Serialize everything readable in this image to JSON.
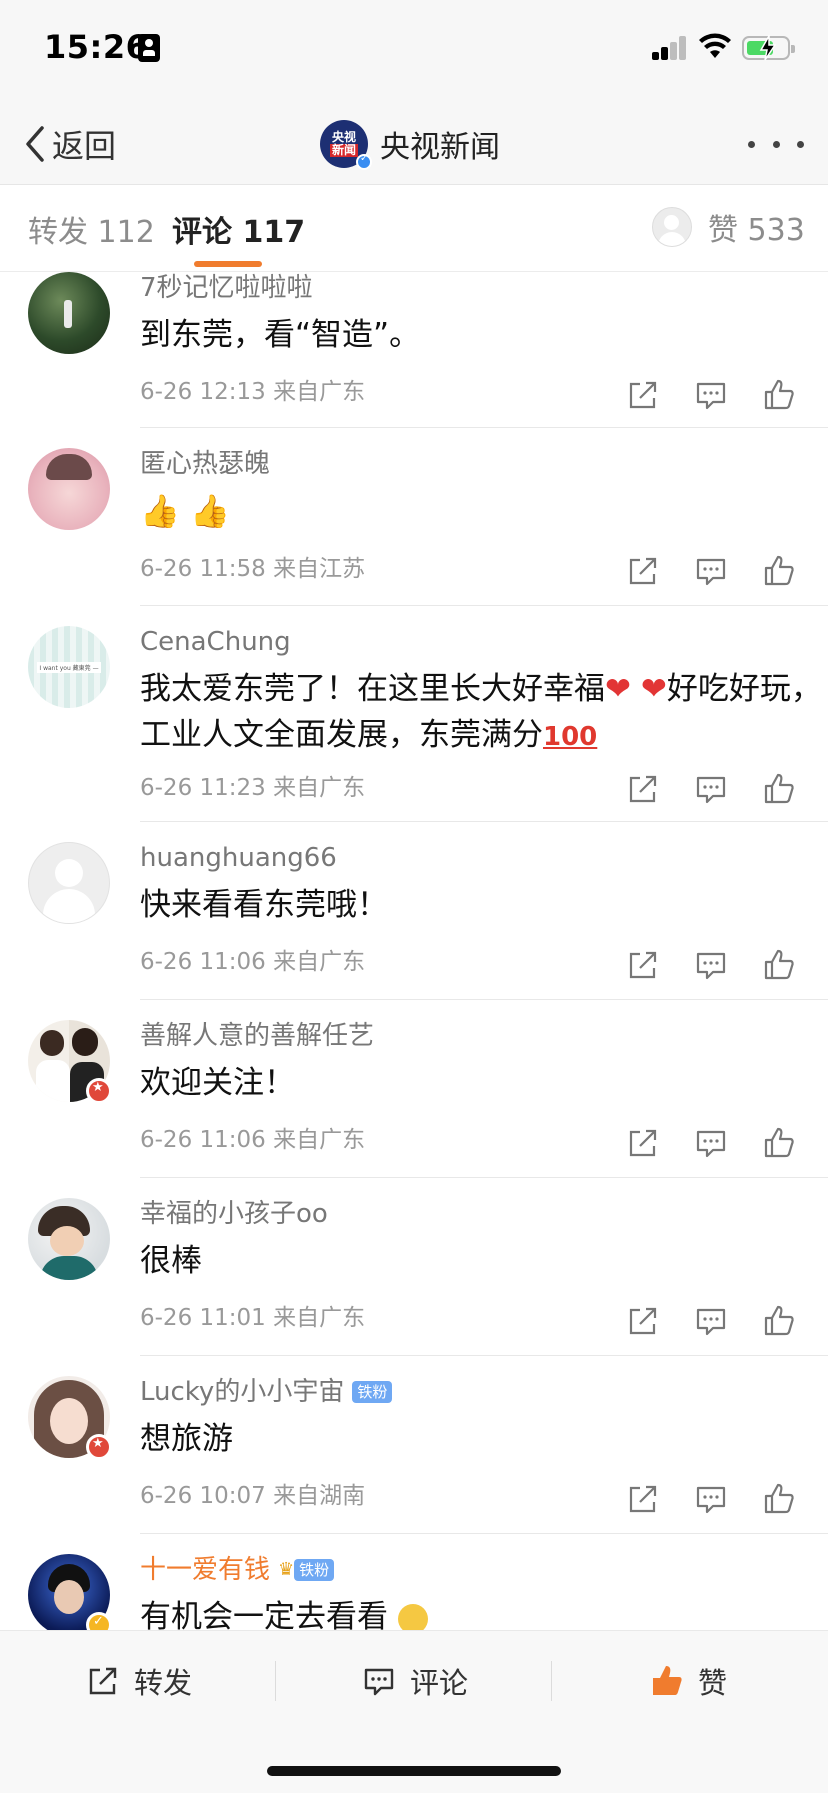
{
  "status_bar": {
    "time": "15:26"
  },
  "nav": {
    "back_label": "返回",
    "title": "央视新闻",
    "logo_line1": "央视",
    "logo_line2": "新闻"
  },
  "tabs": {
    "repost": "转发 112",
    "comment": "评论 117",
    "likes": "赞 533"
  },
  "comments": [
    {
      "name": "7秒记忆啦啦啦",
      "text": "到东莞，看“智造”。",
      "time": "6-26 12:13",
      "location": "来自广东"
    },
    {
      "name": "匿心热瑟魄",
      "text": "",
      "emoji": "👍 👍",
      "time": "6-26 11:58",
      "location": "来自江苏"
    },
    {
      "name": "CenaChung",
      "text_a": "我太爱东莞了！在这里长大好幸福",
      "heart": "❤",
      "text_b": "好吃好玩，工业人文全面发展，东莞满分",
      "hundred": "100",
      "time": "6-26 11:23",
      "location": "来自广东",
      "avatar_text": "I want you 藏東莞 —"
    },
    {
      "name": "huanghuang66",
      "text": "快来看看东莞哦！",
      "time": "6-26 11:06",
      "location": "来自广东"
    },
    {
      "name": "善解人意的善解任艺",
      "text": "欢迎关注！",
      "time": "6-26 11:06",
      "location": "来自广东"
    },
    {
      "name": "幸福的小孩子oo",
      "text": "很棒",
      "time": "6-26 11:01",
      "location": "来自广东"
    },
    {
      "name": "Lucky的小小宇宙",
      "badge": "铁粉",
      "text": "想旅游",
      "time": "6-26 10:07",
      "location": "来自湖南"
    },
    {
      "name": "十一爱有钱",
      "badge": "铁粉",
      "text": "有机会一定去看看"
    }
  ],
  "bottom_bar": {
    "repost": "转发",
    "comment": "评论",
    "like": "赞"
  },
  "colors": {
    "accent_orange": "#f07c2e",
    "like_orange": "#f07c2e",
    "fan_badge_blue": "#6fa8f3",
    "text_dark": "#111111",
    "text_gray": "#999999"
  },
  "icons": [
    "back-chevron-icon",
    "more-dots-icon",
    "share-icon",
    "comment-icon",
    "like-icon",
    "signal-icon",
    "wifi-icon",
    "battery-icon"
  ]
}
